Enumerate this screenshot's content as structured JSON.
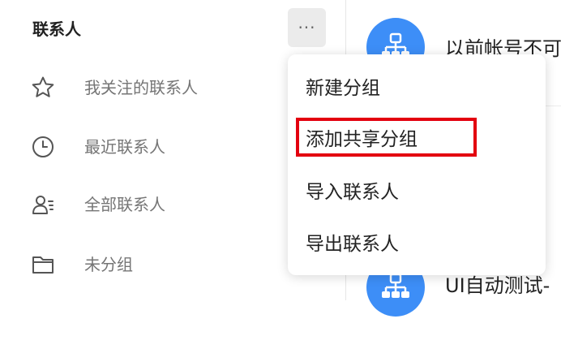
{
  "sidebar": {
    "title": "联系人",
    "more_icon": "ellipsis-icon",
    "items": [
      {
        "label": "我关注的联系人",
        "icon": "star-icon"
      },
      {
        "label": "最近联系人",
        "icon": "clock-icon"
      },
      {
        "label": "全部联系人",
        "icon": "contacts-list-icon"
      },
      {
        "label": "未分组",
        "icon": "folder-icon"
      }
    ]
  },
  "contacts": [
    {
      "name": "以前帐号不可"
    },
    {
      "name": "UI自动测试-"
    }
  ],
  "menu": {
    "items": [
      {
        "label": "新建分组"
      },
      {
        "label": "添加共享分组",
        "highlighted": true
      },
      {
        "label": "导入联系人"
      },
      {
        "label": "导出联系人"
      }
    ]
  },
  "colors": {
    "accent": "#3d8ef7",
    "highlight_border": "#e3000f",
    "sidebar_text": "#757575"
  }
}
